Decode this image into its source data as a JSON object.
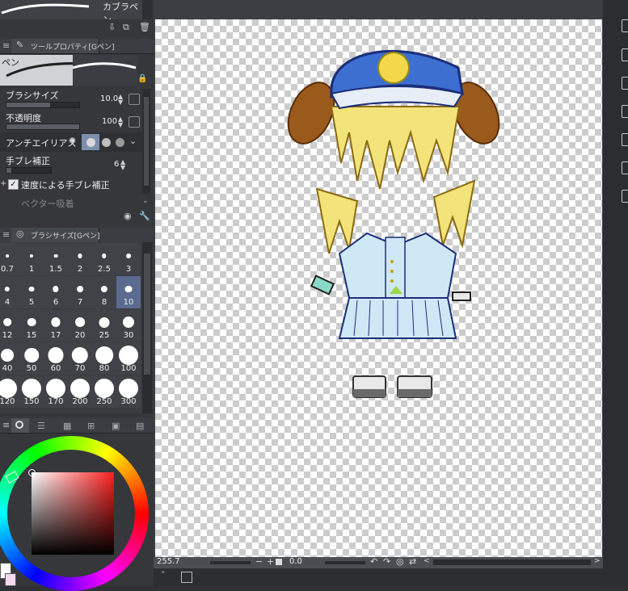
{
  "left_panel": {
    "top_label": "カブラペン",
    "tool_property": {
      "tab_title": "ツールプロパティ[Gペン]",
      "tool_name": "ペン",
      "brush_size_label": "ブラシサイズ",
      "brush_size_value": "10.0",
      "opacity_label": "不透明度",
      "opacity_value": "100",
      "antialias_label": "アンチエイリアス",
      "stabilizer_label": "手ブレ補正",
      "stabilizer_value": "6",
      "speed_stabilizer_label": "速度による手ブレ補正",
      "vector_snap_label": "ベクター吸着"
    },
    "brush_size_panel": {
      "tab_title": "ブラシサイズ[Gペン]",
      "sizes": [
        "0.7",
        "1",
        "1.5",
        "2",
        "2.5",
        "3",
        "4",
        "5",
        "6",
        "7",
        "8",
        "10",
        "12",
        "15",
        "17",
        "20",
        "25",
        "30",
        "40",
        "50",
        "60",
        "70",
        "80",
        "100",
        "120",
        "150",
        "170",
        "200",
        "250",
        "300"
      ],
      "selected": "10"
    }
  },
  "status_bar": {
    "zoom": "255.7",
    "rotation": "0.0"
  },
  "colors": {
    "panel_bg": "#35373b",
    "selected_cell": "#5a6b8f",
    "hat_blue": "#3d6fd0",
    "hair_yellow": "#f2e37a",
    "uniform_light_blue": "#cfe8f5"
  }
}
